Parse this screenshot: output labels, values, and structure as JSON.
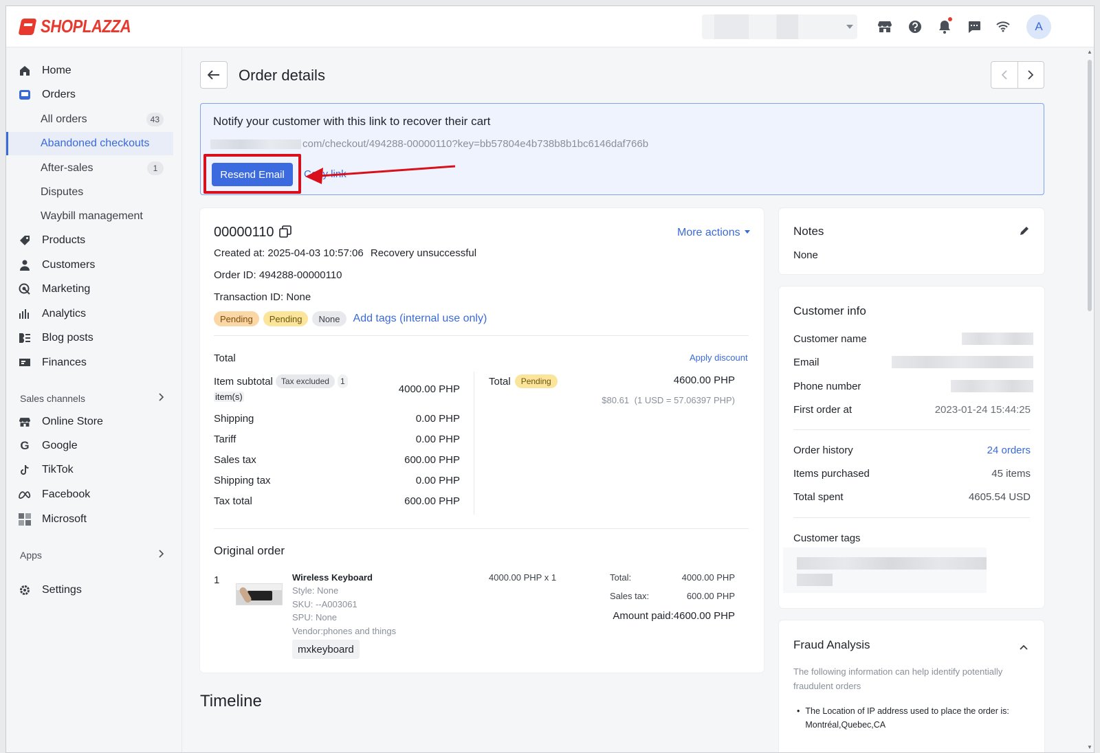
{
  "brand": {
    "name": "SHOPLAZZA",
    "accent": "#e8392f",
    "link_color": "#3a6ad8"
  },
  "topbar": {
    "avatar_letter": "A"
  },
  "sidebar": {
    "home": "Home",
    "orders": "Orders",
    "orders_sub": [
      {
        "label": "All orders",
        "count": "43"
      },
      {
        "label": "Abandoned checkouts"
      },
      {
        "label": "After-sales",
        "count": "1"
      },
      {
        "label": "Disputes"
      },
      {
        "label": "Waybill management"
      }
    ],
    "products": "Products",
    "customers": "Customers",
    "marketing": "Marketing",
    "analytics": "Analytics",
    "blog_posts": "Blog posts",
    "finances": "Finances",
    "sales_channels": "Sales channels",
    "channels": [
      "Online Store",
      "Google",
      "TikTok",
      "Facebook",
      "Microsoft"
    ],
    "apps": "Apps",
    "settings": "Settings"
  },
  "page": {
    "title": "Order details"
  },
  "recover": {
    "title": "Notify your customer with this link to recover their cart",
    "link": "com/checkout/494288-00000110?key=bb57804e4b738b8b1bc6146daf766b",
    "resend": "Resend Email",
    "copy": "Copy link"
  },
  "order": {
    "number": "00000110",
    "more_actions": "More actions",
    "created_label": "Created at:",
    "created_value": "2025-04-03 10:57:06",
    "recovery": "Recovery unsuccessful",
    "order_id": "Order ID: 494288-00000110",
    "transaction_id": "Transaction ID: None",
    "tags": [
      "Pending",
      "Pending",
      "None"
    ],
    "add_tags": "Add tags (internal use only)"
  },
  "totals": {
    "heading": "Total",
    "apply_discount": "Apply discount",
    "item_subtotal": "Item subtotal",
    "tax_excluded": "Tax excluded",
    "items_count": "1",
    "items_unit": "item(s)",
    "item_subtotal_value": "4000.00 PHP",
    "rows": [
      {
        "label": "Shipping",
        "value": "0.00 PHP"
      },
      {
        "label": "Tariff",
        "value": "0.00 PHP"
      },
      {
        "label": "Sales tax",
        "value": "600.00 PHP"
      },
      {
        "label": "Shipping tax",
        "value": "0.00 PHP"
      },
      {
        "label": "Tax total",
        "value": "600.00 PHP"
      }
    ],
    "total_label": "Total",
    "total_status": "Pending",
    "total_value": "4600.00 PHP",
    "usd_value": "$80.61",
    "rate": "(1 USD = 57.06397 PHP)"
  },
  "original_order": {
    "heading": "Original order",
    "index": "1",
    "product": "Wireless Keyboard",
    "style": "Style: None",
    "sku": "SKU: --A003061",
    "spu": "SPU: None",
    "vendor": "Vendor:phones and things",
    "tag": "mxkeyboard",
    "price": "4000.00 PHP x 1",
    "total_label": "Total:",
    "total_value": "4000.00 PHP",
    "sales_tax_label": "Sales tax:",
    "sales_tax_value": "600.00 PHP",
    "amount_paid": "Amount paid:4600.00 PHP"
  },
  "timeline": {
    "heading": "Timeline"
  },
  "notes": {
    "title": "Notes",
    "value": "None"
  },
  "customer": {
    "title": "Customer info",
    "name_label": "Customer name",
    "email_label": "Email",
    "phone_label": "Phone number",
    "first_order_label": "First order at",
    "first_order_value": "2023-01-24 15:44:25",
    "history_label": "Order history",
    "history_value": "24 orders",
    "items_label": "Items purchased",
    "items_value": "45 items",
    "spent_label": "Total spent",
    "spent_value": "4605.54 USD",
    "tags_label": "Customer tags"
  },
  "fraud": {
    "title": "Fraud Analysis",
    "desc": "The following information can help identify potentially fraudulent orders",
    "bullet": "The Location of IP address used to place the order is:",
    "location": "Montréal,Quebec,CA"
  }
}
